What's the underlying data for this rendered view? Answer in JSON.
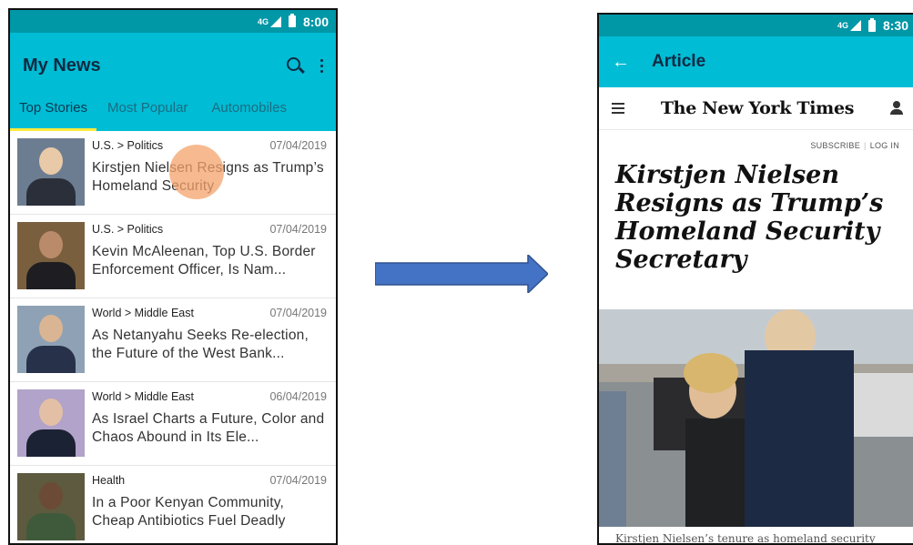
{
  "left_screen": {
    "status": {
      "network": "4G",
      "time": "8:00"
    },
    "app_title": "My News",
    "actions": {
      "search_icon": "search-icon",
      "more_icon": "more-vert-icon"
    },
    "tabs": [
      {
        "label": "Top Stories",
        "active": true
      },
      {
        "label": "Most Popular",
        "active": false
      },
      {
        "label": "Automobiles",
        "active": false
      }
    ],
    "articles": [
      {
        "category": "U.S. > Politics",
        "date": "07/04/2019",
        "headline": "Kirstjen Nielsen Resigns as Trump’s Homeland Security"
      },
      {
        "category": "U.S. > Politics",
        "date": "07/04/2019",
        "headline": "Kevin McAleenan, Top U.S. Border Enforcement Officer, Is Nam..."
      },
      {
        "category": "World > Middle East",
        "date": "07/04/2019",
        "headline": "As Netanyahu Seeks Re-election, the Future of the West Bank..."
      },
      {
        "category": "World > Middle East",
        "date": "06/04/2019",
        "headline": "As Israel Charts a Future, Color and Chaos Abound in Its Ele..."
      },
      {
        "category": "Health",
        "date": "07/04/2019",
        "headline": "In a Poor Kenyan Community, Cheap Antibiotics Fuel Deadly"
      }
    ],
    "colors": {
      "statusbar": "#0097a7",
      "appbar": "#00bcd4",
      "tab_indicator": "#ffeb3b",
      "touch": "#f4a36b"
    }
  },
  "right_screen": {
    "status": {
      "network": "4G",
      "time": "8:30"
    },
    "app_title": "Article",
    "masthead": "The New York Times",
    "subscribe": "SUBSCRIBE",
    "login": "LOG IN",
    "article_title": "Kirstjen Nielsen Resigns as Trump’s Homeland Security Secretary",
    "caption": "Kirstjen Nielsen’s tenure as homeland security"
  },
  "arrow_color": "#4472c4"
}
